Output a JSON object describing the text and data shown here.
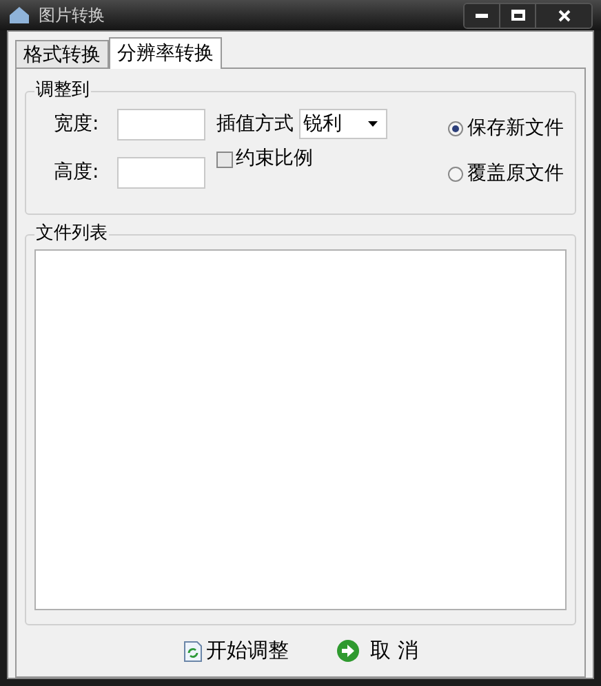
{
  "window": {
    "title": "图片转换"
  },
  "tabs": [
    {
      "label": "格式转换",
      "selected": false
    },
    {
      "label": "分辨率转换",
      "selected": true
    }
  ],
  "resize_group": {
    "title": "调整到",
    "width_label": "宽度:",
    "height_label": "高度:",
    "interpolation_label": "插值方式",
    "interpolation_value": "锐利",
    "keep_ratio": {
      "label": "约束比例",
      "checked": false
    },
    "output_options": [
      {
        "label": "保存新文件",
        "selected": true
      },
      {
        "label": "覆盖原文件",
        "selected": false
      }
    ]
  },
  "file_list": {
    "title": "文件列表"
  },
  "buttons": [
    {
      "kind": "start",
      "label": "开始调整"
    },
    {
      "kind": "cancel",
      "label": "取 消"
    }
  ]
}
